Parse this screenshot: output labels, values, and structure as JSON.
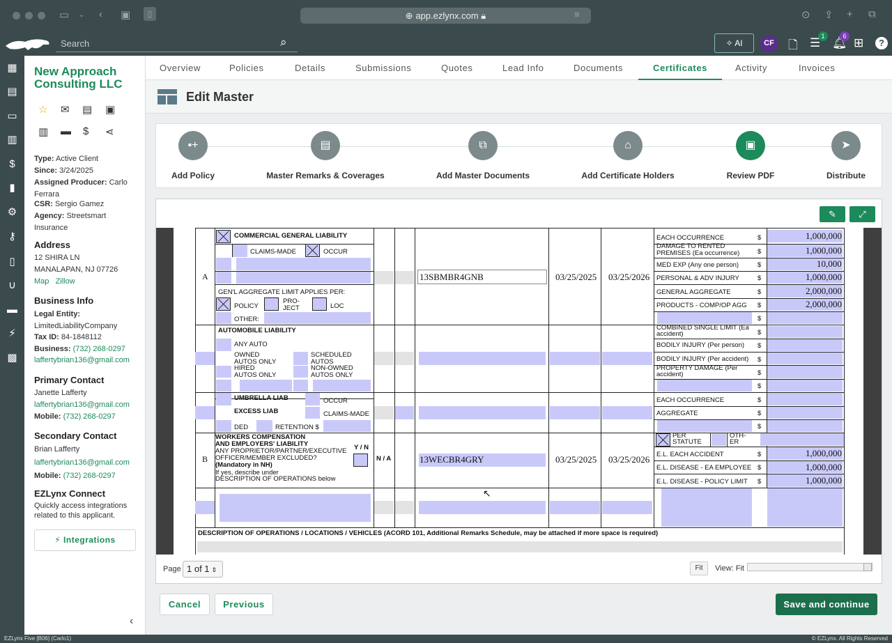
{
  "browser": {
    "url": "app.ezlynx.com"
  },
  "header": {
    "search_placeholder": "Search",
    "ai_label": "AI",
    "avatar_initials": "CF",
    "list_badge": "1",
    "bell_badge": "6"
  },
  "client": {
    "name": "New Approach Consulting LLC",
    "type_label": "Type:",
    "type": "Active Client",
    "since_label": "Since:",
    "since": "3/24/2025",
    "producer_label": "Assigned Producer:",
    "producer": "Carlo Ferrara",
    "csr_label": "CSR:",
    "csr": "Sergio Gamez",
    "agency_label": "Agency:",
    "agency": "Streetsmart Insurance"
  },
  "address": {
    "title": "Address",
    "line1": "12 SHIRA LN",
    "line2": "MANALAPAN, NJ 07726",
    "map": "Map",
    "zillow": "Zillow"
  },
  "business": {
    "title": "Business Info",
    "entity_label": "Legal Entity:",
    "entity": "LimitedLiabilityCompany",
    "taxid_label": "Tax ID:",
    "taxid": "84-1848112",
    "phone_label": "Business:",
    "phone": "(732) 268-0297",
    "email": "laffertybrian136@gmail.com"
  },
  "primary": {
    "title": "Primary Contact",
    "name": "Janette Lafferty",
    "email": "laffertybrian136@gmail.com",
    "mobile_label": "Mobile:",
    "mobile": "(732) 268-0297"
  },
  "secondary": {
    "title": "Secondary Contact",
    "name": "Brian Lafferty",
    "email": "laffertybrian136@gmail.com",
    "mobile_label": "Mobile:",
    "mobile": "(732) 268-0297"
  },
  "connect": {
    "title": "EZLynx Connect",
    "desc": "Quickly access integrations related to this applicant.",
    "button": "Integrations"
  },
  "tabs": [
    "Overview",
    "Policies",
    "Details",
    "Submissions",
    "Quotes",
    "Lead Info",
    "Documents",
    "Certificates",
    "Activity",
    "Invoices"
  ],
  "active_tab": "Certificates",
  "edit_master": {
    "title": "Edit Master"
  },
  "steps": [
    "Add Policy",
    "Master Remarks & Coverages",
    "Add Master Documents",
    "Add Certificate Holders",
    "Review PDF",
    "Distribute"
  ],
  "form": {
    "gl": {
      "title": "COMMERCIAL GENERAL LIABILITY",
      "claims_made": "CLAIMS-MADE",
      "occur": "OCCUR",
      "agg_title": "GEN'L AGGREGATE LIMIT APPLIES PER:",
      "policy": "POLICY",
      "project": "PRO-\nJECT",
      "loc": "LOC",
      "other": "OTHER:",
      "letter": "A",
      "policy_no": "13SBMBR4GNB",
      "eff": "03/25/2025",
      "exp": "03/25/2026",
      "limits": [
        {
          "label": "EACH OCCURRENCE",
          "value": "1,000,000"
        },
        {
          "label": "DAMAGE TO RENTED PREMISES (Ea occurrence)",
          "value": "1,000,000"
        },
        {
          "label": "MED EXP (Any one person)",
          "value": "10,000"
        },
        {
          "label": "PERSONAL & ADV INJURY",
          "value": "1,000,000"
        },
        {
          "label": "GENERAL AGGREGATE",
          "value": "2,000,000"
        },
        {
          "label": "PRODUCTS - COMP/OP AGG",
          "value": "2,000,000"
        }
      ]
    },
    "auto": {
      "title": "AUTOMOBILE LIABILITY",
      "any_auto": "ANY AUTO",
      "owned": "OWNED\nAUTOS ONLY",
      "hired": "HIRED\nAUTOS ONLY",
      "scheduled": "SCHEDULED\nAUTOS",
      "nonowned": "NON-OWNED\nAUTOS ONLY",
      "limits": [
        "COMBINED SINGLE LIMIT (Ea accident)",
        "BODILY INJURY (Per person)",
        "BODILY INJURY (Per accident)",
        "PROPERTY DAMAGE (Per accident)"
      ]
    },
    "umb": {
      "umbrella": "UMBRELLA LIAB",
      "excess": "EXCESS LIAB",
      "occur": "OCCUR",
      "claims_made": "CLAIMS-MADE",
      "ded": "DED",
      "retention": "RETENTION $",
      "each": "EACH OCCURRENCE",
      "aggregate": "AGGREGATE"
    },
    "wc": {
      "title": "WORKERS COMPENSATION\nAND EMPLOYERS' LIABILITY",
      "yn": "Y / N",
      "q": "ANY PROPRIETOR/PARTNER/EXECUTIVE\nOFFICER/MEMBER EXCLUDED?",
      "mand": "(Mandatory in NH)",
      "ifyes": "If yes, describe under\nDESCRIPTION OF OPERATIONS below",
      "na": "N / A",
      "letter": "B",
      "policy_no": "13WECBR4GRY",
      "eff": "03/25/2025",
      "exp": "03/25/2026",
      "per_statute": "PER\nSTATUTE",
      "oth": "OTH-\nER",
      "limits": [
        {
          "label": "E.L. EACH ACCIDENT",
          "value": "1,000,000"
        },
        {
          "label": "E.L. DISEASE - EA EMPLOYEE",
          "value": "1,000,000"
        },
        {
          "label": "E.L. DISEASE - POLICY LIMIT",
          "value": "1,000,000"
        }
      ]
    },
    "dollar": "$",
    "desc": "DESCRIPTION OF OPERATIONS / LOCATIONS / VEHICLES  (ACORD 101, Additional Remarks Schedule, may be attached if more space is required)"
  },
  "pager": {
    "page_label": "Page",
    "page_value": "1 of 1",
    "fit": "Fit",
    "view": "View: Fit"
  },
  "buttons": {
    "cancel": "Cancel",
    "previous": "Previous",
    "save": "Save and continue"
  },
  "status": {
    "left": "EZLynx Five [B06] (Carlo1)",
    "right": "© EZLynx. All Rights Reserved"
  }
}
